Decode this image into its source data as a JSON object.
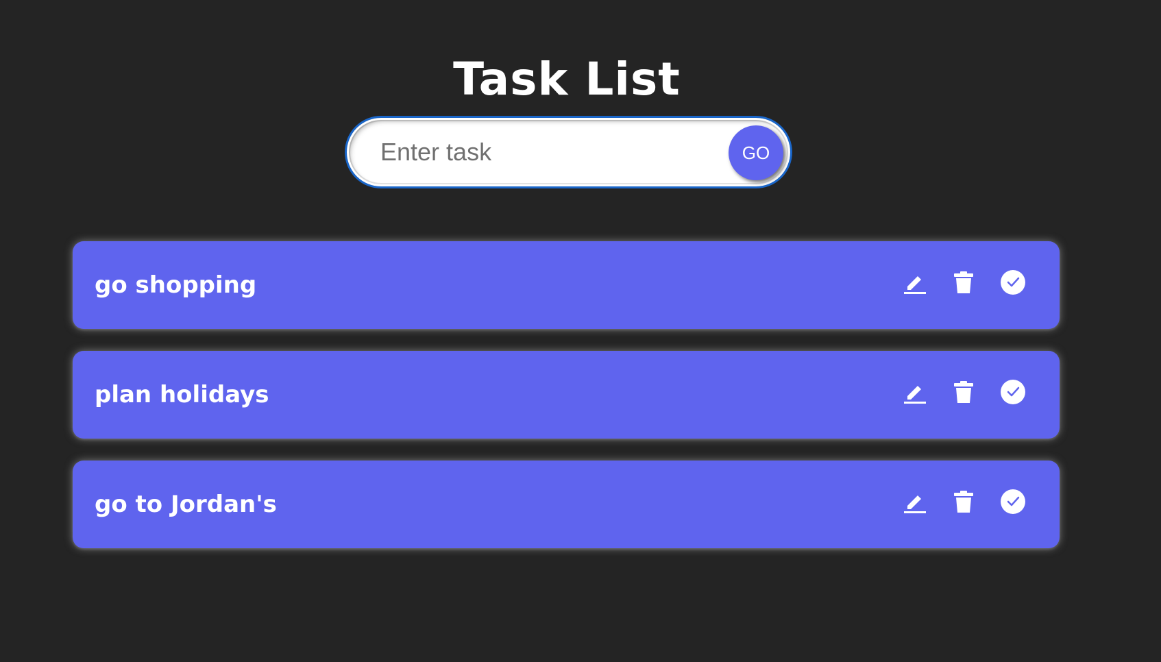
{
  "app": {
    "title": "Task List"
  },
  "task_form": {
    "placeholder": "Enter task",
    "value": "",
    "submit_label": "GO"
  },
  "tasks": [
    {
      "label": "go shopping"
    },
    {
      "label": "plan holidays"
    },
    {
      "label": "go to Jordan's"
    }
  ],
  "task_actions": [
    "pencil-icon",
    "trash-icon",
    "check-circle-icon"
  ],
  "colors": {
    "background": "#242424",
    "accent": "#5f64ee",
    "input_border": "#1a66c9",
    "text": "#ffffff"
  }
}
